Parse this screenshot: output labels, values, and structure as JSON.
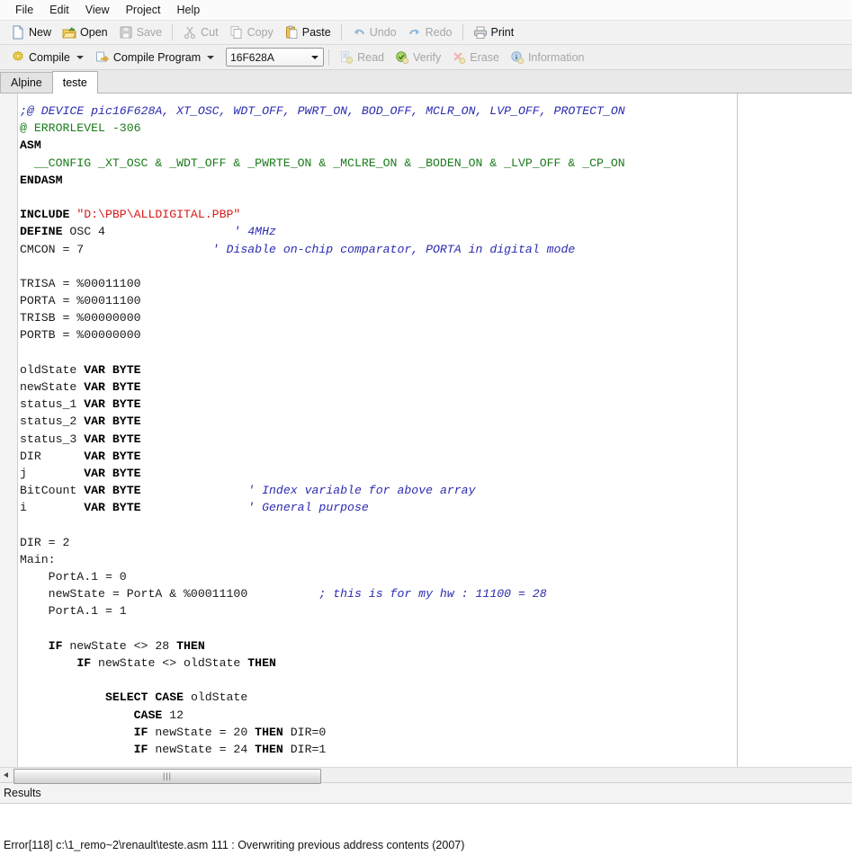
{
  "menubar": {
    "items": [
      {
        "label": "File"
      },
      {
        "label": "Edit"
      },
      {
        "label": "View"
      },
      {
        "label": "Project"
      },
      {
        "label": "Help"
      }
    ]
  },
  "toolbar_main": {
    "items": [
      {
        "label": "New",
        "icon": "new-file-icon",
        "enabled": true
      },
      {
        "label": "Open",
        "icon": "open-folder-icon",
        "enabled": true
      },
      {
        "label": "Save",
        "icon": "save-disk-icon",
        "enabled": false
      },
      {
        "label": "Cut",
        "icon": "scissors-icon",
        "enabled": false
      },
      {
        "label": "Copy",
        "icon": "copy-icon",
        "enabled": false
      },
      {
        "label": "Paste",
        "icon": "clipboard-icon",
        "enabled": true
      },
      {
        "label": "Undo",
        "icon": "undo-arrow-icon",
        "enabled": false
      },
      {
        "label": "Redo",
        "icon": "redo-arrow-icon",
        "enabled": false
      },
      {
        "label": "Print",
        "icon": "printer-icon",
        "enabled": true
      }
    ]
  },
  "toolbar_compile": {
    "compile_label": "Compile",
    "compile_program_label": "Compile Program",
    "device_combo_value": "16F628A",
    "items": [
      {
        "label": "Read",
        "icon": "read-icon",
        "enabled": false
      },
      {
        "label": "Verify",
        "icon": "verify-check-icon",
        "enabled": false
      },
      {
        "label": "Erase",
        "icon": "erase-icon",
        "enabled": false
      },
      {
        "label": "Information",
        "icon": "information-icon",
        "enabled": false
      }
    ]
  },
  "tabs": [
    {
      "label": "Alpine",
      "active": false
    },
    {
      "label": "teste",
      "active": true
    }
  ],
  "editor": {
    "margin_column_x": 819,
    "lines": [
      [
        {
          "t": ";@ DEVICE pic16F628A, XT_OSC, WDT_OFF, PWRT_ON, BOD_OFF, MCLR_ON, LVP_OFF, PROTECT_ON",
          "c": "com"
        }
      ],
      [
        {
          "t": "@ ERRORLEVEL -306",
          "c": "dir"
        }
      ],
      [
        {
          "t": "ASM",
          "c": "kw"
        }
      ],
      [
        {
          "t": "  __CONFIG _XT_OSC & _WDT_OFF & _PWRTE_ON & _MCLRE_ON & _BODEN_ON & _LVP_OFF & _CP_ON",
          "c": "dir"
        }
      ],
      [
        {
          "t": "ENDASM",
          "c": "kw"
        }
      ],
      [
        {
          "t": "",
          "c": "plain"
        }
      ],
      [
        {
          "t": "INCLUDE ",
          "c": "kw"
        },
        {
          "t": "\"D:\\PBP\\ALLDIGITAL.PBP\"",
          "c": "str"
        }
      ],
      [
        {
          "t": "DEFINE ",
          "c": "kw"
        },
        {
          "t": "OSC 4                  ",
          "c": "plain"
        },
        {
          "t": "' 4MHz",
          "c": "com"
        }
      ],
      [
        {
          "t": "CMCON = 7                  ",
          "c": "plain"
        },
        {
          "t": "' Disable on-chip comparator, PORTA in digital mode",
          "c": "com"
        }
      ],
      [
        {
          "t": "",
          "c": "plain"
        }
      ],
      [
        {
          "t": "TRISA = %00011100",
          "c": "plain"
        }
      ],
      [
        {
          "t": "PORTA = %00011100",
          "c": "plain"
        }
      ],
      [
        {
          "t": "TRISB = %00000000",
          "c": "plain"
        }
      ],
      [
        {
          "t": "PORTB = %00000000",
          "c": "plain"
        }
      ],
      [
        {
          "t": "",
          "c": "plain"
        }
      ],
      [
        {
          "t": "oldState ",
          "c": "plain"
        },
        {
          "t": "VAR BYTE",
          "c": "kw"
        }
      ],
      [
        {
          "t": "newState ",
          "c": "plain"
        },
        {
          "t": "VAR BYTE",
          "c": "kw"
        }
      ],
      [
        {
          "t": "status_1 ",
          "c": "plain"
        },
        {
          "t": "VAR BYTE",
          "c": "kw"
        }
      ],
      [
        {
          "t": "status_2 ",
          "c": "plain"
        },
        {
          "t": "VAR BYTE",
          "c": "kw"
        }
      ],
      [
        {
          "t": "status_3 ",
          "c": "plain"
        },
        {
          "t": "VAR BYTE",
          "c": "kw"
        }
      ],
      [
        {
          "t": "DIR      ",
          "c": "plain"
        },
        {
          "t": "VAR BYTE",
          "c": "kw"
        }
      ],
      [
        {
          "t": "j        ",
          "c": "plain"
        },
        {
          "t": "VAR BYTE",
          "c": "kw"
        }
      ],
      [
        {
          "t": "BitCount ",
          "c": "plain"
        },
        {
          "t": "VAR BYTE",
          "c": "kw"
        },
        {
          "t": "               ",
          "c": "plain"
        },
        {
          "t": "' Index variable for above array",
          "c": "com"
        }
      ],
      [
        {
          "t": "i        ",
          "c": "plain"
        },
        {
          "t": "VAR BYTE",
          "c": "kw"
        },
        {
          "t": "               ",
          "c": "plain"
        },
        {
          "t": "' General purpose",
          "c": "com"
        }
      ],
      [
        {
          "t": "",
          "c": "plain"
        }
      ],
      [
        {
          "t": "DIR = 2",
          "c": "plain"
        }
      ],
      [
        {
          "t": "Main:",
          "c": "plain"
        }
      ],
      [
        {
          "t": "    PortA.1 = 0",
          "c": "plain"
        }
      ],
      [
        {
          "t": "    newState = PortA & %00011100          ",
          "c": "plain"
        },
        {
          "t": "; this is for my hw : 11100 = 28",
          "c": "com"
        }
      ],
      [
        {
          "t": "    PortA.1 = 1",
          "c": "plain"
        }
      ],
      [
        {
          "t": "",
          "c": "plain"
        }
      ],
      [
        {
          "t": "    ",
          "c": "plain"
        },
        {
          "t": "IF",
          "c": "kw"
        },
        {
          "t": " newState <> 28 ",
          "c": "plain"
        },
        {
          "t": "THEN",
          "c": "kw"
        }
      ],
      [
        {
          "t": "        ",
          "c": "plain"
        },
        {
          "t": "IF",
          "c": "kw"
        },
        {
          "t": " newState <> oldState ",
          "c": "plain"
        },
        {
          "t": "THEN",
          "c": "kw"
        }
      ],
      [
        {
          "t": "",
          "c": "plain"
        }
      ],
      [
        {
          "t": "            ",
          "c": "plain"
        },
        {
          "t": "SELECT CASE",
          "c": "kw"
        },
        {
          "t": " oldState",
          "c": "plain"
        }
      ],
      [
        {
          "t": "                ",
          "c": "plain"
        },
        {
          "t": "CASE",
          "c": "kw"
        },
        {
          "t": " 12",
          "c": "plain"
        }
      ],
      [
        {
          "t": "                ",
          "c": "plain"
        },
        {
          "t": "IF",
          "c": "kw"
        },
        {
          "t": " newState = 20 ",
          "c": "plain"
        },
        {
          "t": "THEN",
          "c": "kw"
        },
        {
          "t": " DIR=0",
          "c": "plain"
        }
      ],
      [
        {
          "t": "                ",
          "c": "plain"
        },
        {
          "t": "IF",
          "c": "kw"
        },
        {
          "t": " newState = 24 ",
          "c": "plain"
        },
        {
          "t": "THEN",
          "c": "kw"
        },
        {
          "t": " DIR=1",
          "c": "plain"
        }
      ]
    ]
  },
  "hscrollbar": {
    "grip": "|||"
  },
  "results": {
    "header_label": "Results",
    "messages": [
      "Error[118] c:\\1_remo~2\\renault\\teste.asm 111 : Overwriting previous address contents (2007)"
    ]
  },
  "colors": {
    "comment": "#2b2bb0",
    "directive": "#1a7a1a",
    "string": "#d51919",
    "keyword": "#000000",
    "editor_bg": "#ffffff",
    "chrome_bg": "#f1f1f1"
  }
}
